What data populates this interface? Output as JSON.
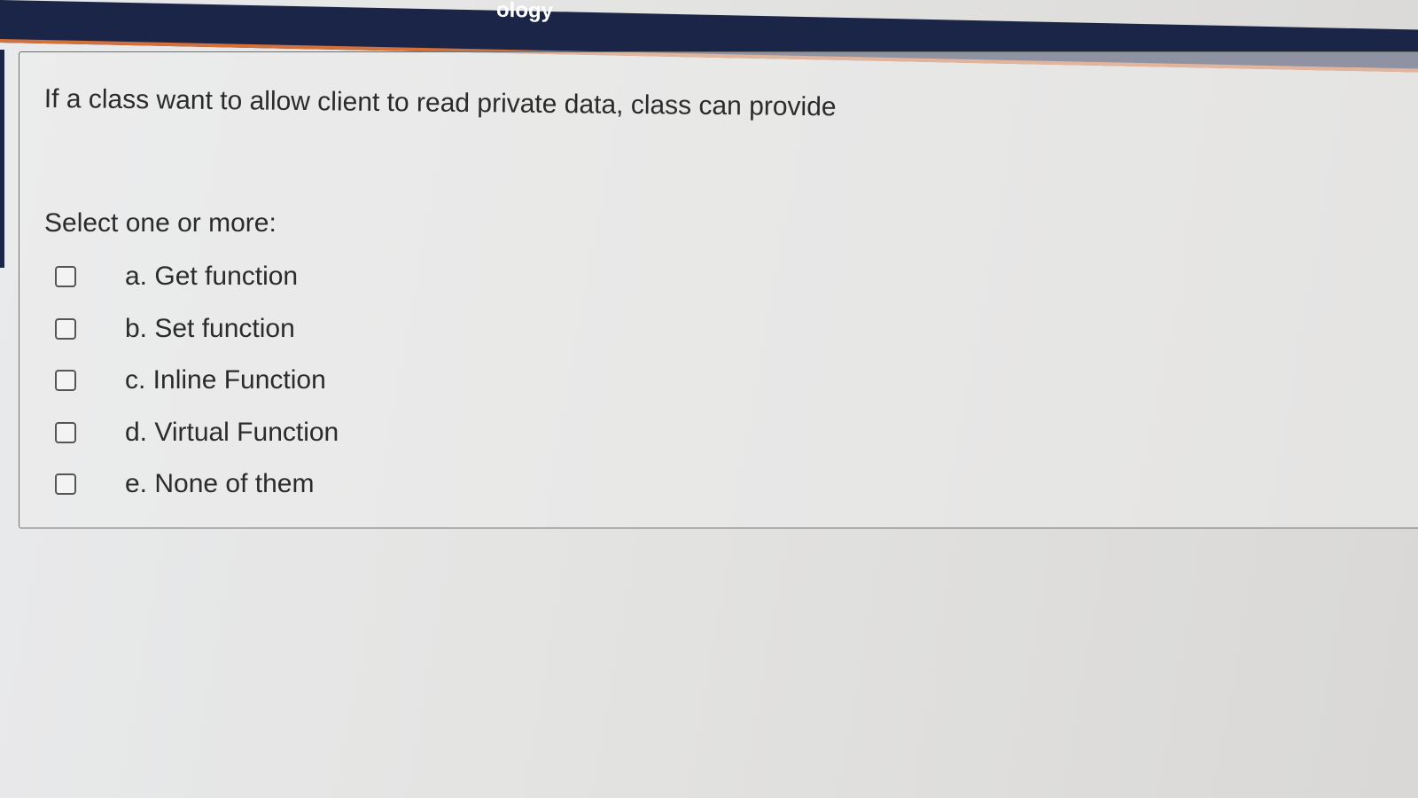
{
  "header": {
    "title_fragment": "ology"
  },
  "question": {
    "text": "If a class want to allow client to read private data, class can provide",
    "prompt": "Select one or more:",
    "options": [
      {
        "label": "a. Get function",
        "checked": false
      },
      {
        "label": "b. Set function",
        "checked": false
      },
      {
        "label": "c. Inline Function",
        "checked": false
      },
      {
        "label": "d. Virtual Function",
        "checked": false
      },
      {
        "label": "e. None of them",
        "checked": false
      }
    ]
  },
  "colors": {
    "header_bg": "#1b2547",
    "header_accent": "#d4703a",
    "text": "#2b2b2b",
    "border": "#6f6f6f"
  }
}
